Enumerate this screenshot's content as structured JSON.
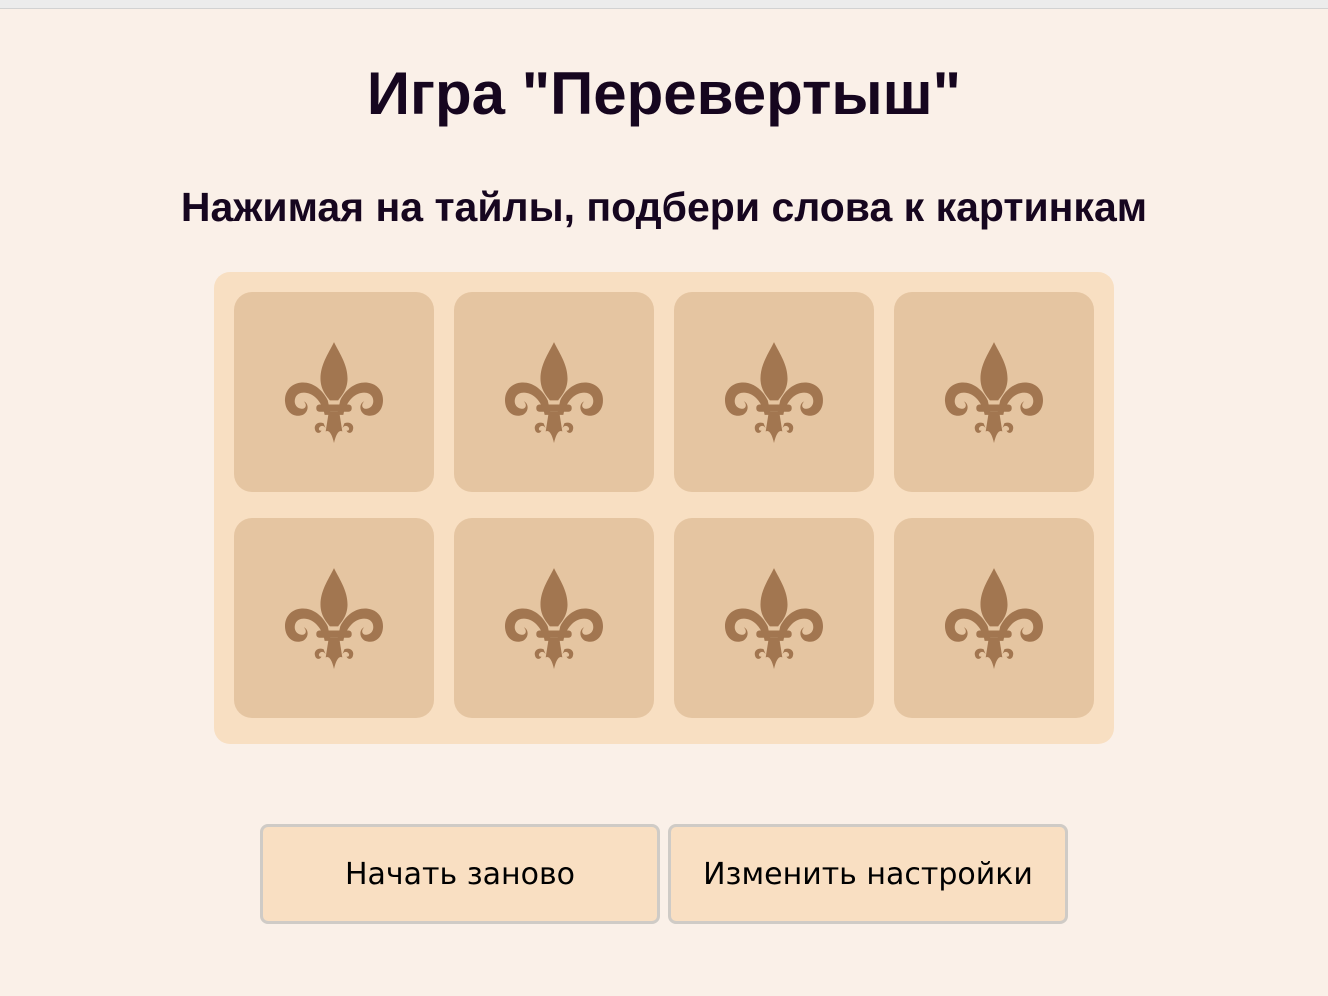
{
  "game": {
    "title": "Игра \"Перевертыш\"",
    "instruction": "Нажимая на тайлы, подбери слова к картинкам"
  },
  "board": {
    "rows": 2,
    "columns": 4,
    "tile_back_icon": "fleur-de-lis-icon",
    "tiles_face_down": 8
  },
  "buttons": {
    "restart_label": "Начать заново",
    "settings_label": "Изменить настройки"
  },
  "colors": {
    "page_background": "#faf0e8",
    "board_background": "#f8dfc2",
    "tile_background": "#e5c5a1",
    "icon_color": "#a27650",
    "button_background": "#f9dfc2",
    "button_border": "#cfcbc6",
    "text": "#16061f"
  }
}
